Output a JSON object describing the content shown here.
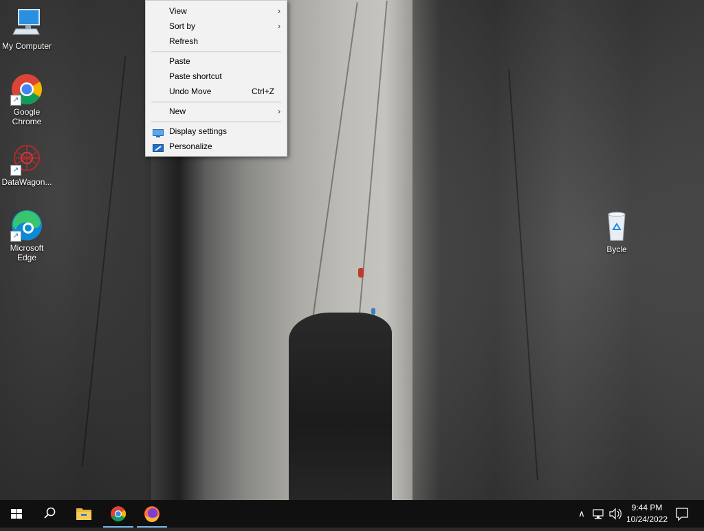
{
  "desktop": {
    "icons": [
      {
        "label": "My Computer"
      },
      {
        "label": "Google Chrome"
      },
      {
        "label": "DataWagon..."
      },
      {
        "label": "Microsoft Edge"
      },
      {
        "label": "Bycle"
      }
    ]
  },
  "context_menu": {
    "items": [
      {
        "label": "View",
        "submenu": true
      },
      {
        "label": "Sort by",
        "submenu": true
      },
      {
        "label": "Refresh"
      },
      {
        "label": "Paste"
      },
      {
        "label": "Paste shortcut"
      },
      {
        "label": "Undo Move",
        "shortcut": "Ctrl+Z"
      },
      {
        "label": "New",
        "submenu": true
      },
      {
        "label": "Display settings",
        "icon": "display-icon"
      },
      {
        "label": "Personalize",
        "icon": "personalize-icon"
      }
    ],
    "arrow_glyph": "›"
  },
  "taskbar": {
    "buttons": [
      {
        "icon": "windows-start-icon"
      },
      {
        "icon": "search-icon"
      },
      {
        "icon": "file-explorer-icon"
      },
      {
        "icon": "chrome-icon",
        "active": true
      },
      {
        "icon": "firefox-icon",
        "active": true
      }
    ],
    "tray": {
      "chevron_glyph": "∧",
      "clock_time": "9:44 PM",
      "clock_date": "10/24/2022"
    }
  },
  "colors": {
    "taskbar_bg": "#101010",
    "menu_bg": "#f2f2f2",
    "active_indicator": "#76b9ed"
  }
}
